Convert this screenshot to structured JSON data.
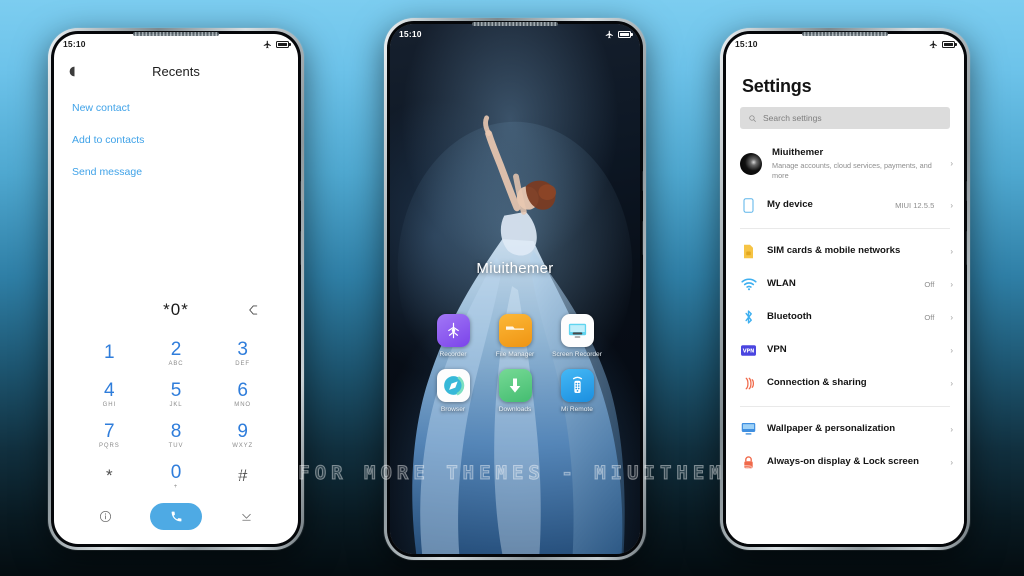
{
  "background": {
    "top_color": "#7ccdf0",
    "bottom_color": "#040c10"
  },
  "watermark": {
    "text": "VISIT FOR MORE THEMES - MIUITHEMER.COM"
  },
  "phone_dialer": {
    "status_bar": {
      "time": "15:10",
      "icons": [
        "airplane-mode-icon",
        "battery-icon"
      ]
    },
    "header": {
      "left_icon": "search-glyph-icon",
      "title": "Recents"
    },
    "links": [
      {
        "label": "New contact"
      },
      {
        "label": "Add to contacts"
      },
      {
        "label": "Send message"
      }
    ],
    "entry": {
      "number": "*0*",
      "backspace_icon": "backspace-icon"
    },
    "keys": [
      {
        "digit": "1",
        "letters": ""
      },
      {
        "digit": "2",
        "letters": "ABC"
      },
      {
        "digit": "3",
        "letters": "DEF"
      },
      {
        "digit": "4",
        "letters": "GHI"
      },
      {
        "digit": "5",
        "letters": "JKL"
      },
      {
        "digit": "6",
        "letters": "MNO"
      },
      {
        "digit": "7",
        "letters": "PQRS"
      },
      {
        "digit": "8",
        "letters": "TUV"
      },
      {
        "digit": "9",
        "letters": "WXYZ"
      },
      {
        "digit": "*",
        "letters": ""
      },
      {
        "digit": "0",
        "letters": "+"
      },
      {
        "digit": "#",
        "letters": ""
      }
    ],
    "bottom_bar": {
      "info_icon": "info-circle-icon",
      "call_icon": "phone-handset-icon",
      "call_button_color": "#4eaae4",
      "collapse_icon": "chevron-down-icon"
    },
    "accent_color": "#3fa2e8",
    "digit_color": "#2f7ddb"
  },
  "phone_home": {
    "status_bar": {
      "time": "15:10",
      "icons": [
        "airplane-mode-icon",
        "battery-icon"
      ]
    },
    "wallpaper_label": "Miuithemer",
    "apps": [
      {
        "label": "Recorder",
        "icon": "recorder-icon",
        "color": "#8c5cf0"
      },
      {
        "label": "File Manager",
        "icon": "folder-icon",
        "color": "#f5a623"
      },
      {
        "label": "Screen Recorder",
        "icon": "monitor-icon",
        "color": "#ffffff"
      },
      {
        "label": "Browser",
        "icon": "compass-icon",
        "color": "#ffffff"
      },
      {
        "label": "Downloads",
        "icon": "download-arrow-icon",
        "color": "#5ec97f"
      },
      {
        "label": "Mi Remote",
        "icon": "remote-control-icon",
        "color": "#2aa3ef"
      }
    ]
  },
  "phone_settings": {
    "status_bar": {
      "time": "15:10",
      "icons": [
        "airplane-mode-icon",
        "battery-icon"
      ]
    },
    "title": "Settings",
    "search": {
      "placeholder": "Search settings",
      "icon": "search-icon"
    },
    "account_row": {
      "name": "Miuithemer",
      "subtitle": "Manage accounts, cloud services, payments, and more",
      "icon": "avatar",
      "arrow": "›"
    },
    "device_row": {
      "label": "My device",
      "value": "MIUI 12.5.5",
      "icon": "device-icon",
      "arrow": "›"
    },
    "items": [
      {
        "label": "SIM cards & mobile networks",
        "value": "",
        "icon": "sim-card-icon",
        "color": "#f6c445",
        "arrow": "›"
      },
      {
        "label": "WLAN",
        "value": "Off",
        "icon": "wifi-icon",
        "color": "#3fb0f0",
        "arrow": "›"
      },
      {
        "label": "Bluetooth",
        "value": "Off",
        "icon": "bluetooth-icon",
        "color": "#3fb0f0",
        "arrow": "›"
      },
      {
        "label": "VPN",
        "value": "",
        "icon": "vpn-icon",
        "color": "#4a45e0",
        "arrow": "›"
      },
      {
        "label": "Connection & sharing",
        "value": "",
        "icon": "connection-sharing-icon",
        "color": "#f0694a",
        "arrow": "›"
      }
    ],
    "items2": [
      {
        "label": "Wallpaper & personalization",
        "value": "",
        "icon": "wallpaper-icon",
        "color": "#3f8fe0",
        "arrow": "›"
      },
      {
        "label": "Always-on display & Lock screen",
        "value": "",
        "icon": "lock-icon",
        "color": "#f0694a",
        "arrow": "›"
      }
    ]
  }
}
